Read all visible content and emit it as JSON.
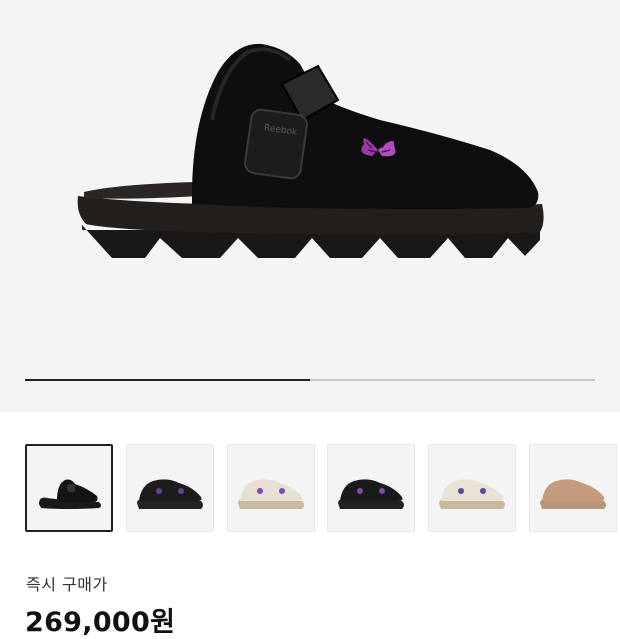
{
  "product": {
    "brand_mark": "Reebok",
    "purchase_label": "즉시 구매가",
    "price": "269,000원"
  },
  "gallery": {
    "progress": 0.5,
    "selected_index": 0,
    "thumbnails": [
      {
        "color": "#141414",
        "accent": "#141414",
        "style": "mule"
      },
      {
        "color": "#1c1c1c",
        "accent": "#6a3fa0",
        "style": "shoe"
      },
      {
        "color": "#e8e0d4",
        "accent": "#7d4bb0",
        "style": "shoe-cream"
      },
      {
        "color": "#1a1a1a",
        "accent": "#7d4bb0",
        "style": "shoe"
      },
      {
        "color": "#e9e3d6",
        "accent": "#5a4a9a",
        "style": "shoe-cream"
      },
      {
        "color": "#c49b7f",
        "accent": "#c49b7f",
        "style": "tan"
      }
    ]
  },
  "colors": {
    "hero_bg": "#f4f4f4",
    "shoe_black": "#0d0d0d",
    "butterfly_purple": "#9a3aa6"
  }
}
